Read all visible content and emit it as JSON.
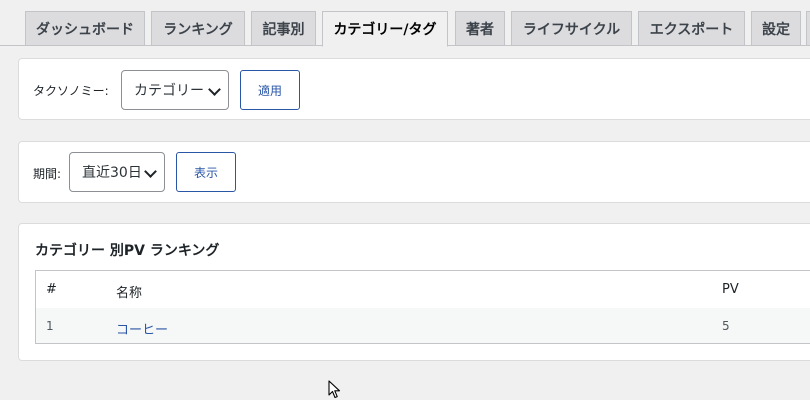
{
  "tabs": [
    {
      "label": "ダッシュボード"
    },
    {
      "label": "ランキング"
    },
    {
      "label": "記事別"
    },
    {
      "label": "カテゴリー/タグ",
      "active": true
    },
    {
      "label": "著者"
    },
    {
      "label": "ライフサイクル"
    },
    {
      "label": "エクスポート"
    },
    {
      "label": "設定"
    }
  ],
  "taxonomy": {
    "label": "タクソノミー:",
    "selected": "カテゴリー",
    "apply_label": "適用"
  },
  "period": {
    "label": "期間:",
    "selected": "直近30日",
    "show_label": "表示"
  },
  "ranking": {
    "title": "カテゴリー 別PV ランキング",
    "columns": [
      "#",
      "名称",
      "PV"
    ],
    "rows": [
      {
        "rank": "1",
        "name": "コーヒー",
        "pv": "5"
      }
    ]
  },
  "colors": {
    "accent": "#2a56a6",
    "background": "#f0f0f1"
  }
}
